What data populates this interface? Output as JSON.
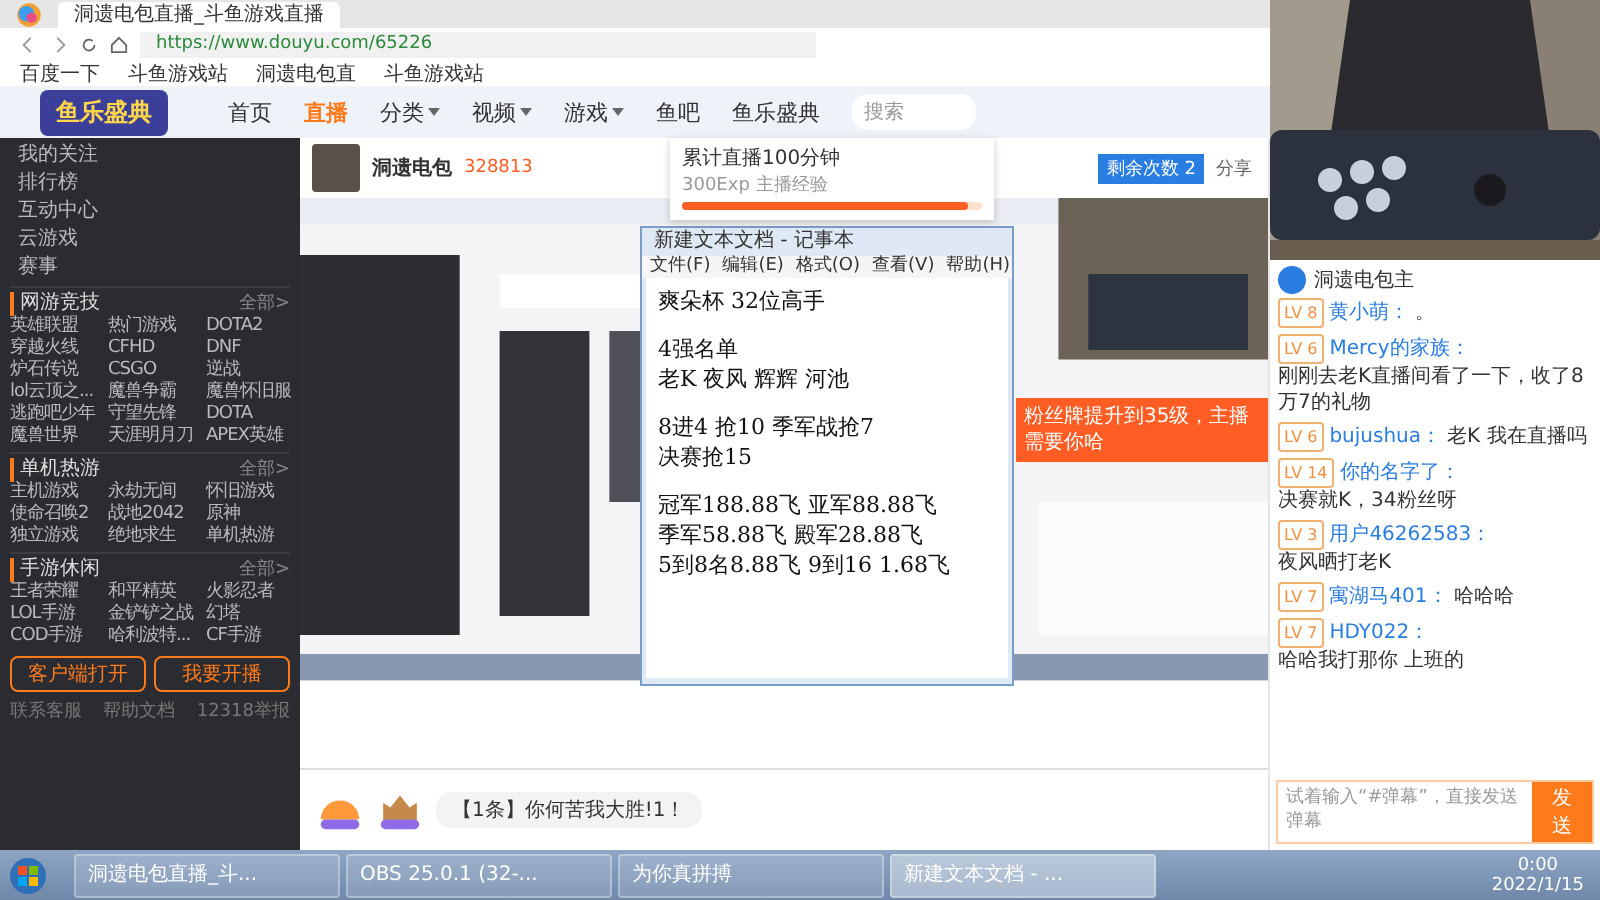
{
  "browser": {
    "tab_title": "洞遗电包直播_斗鱼游戏直播",
    "url": "https://www.douyu.com/65226",
    "bookmarks": [
      "百度一下",
      "斗鱼游戏站",
      "洞遗电包直",
      "斗鱼游戏站"
    ]
  },
  "site_nav": {
    "logo_text": "鱼乐盛典",
    "items": [
      {
        "label": "首页",
        "selected": false,
        "dropdown": false
      },
      {
        "label": "直播",
        "selected": true,
        "dropdown": false
      },
      {
        "label": "分类",
        "selected": false,
        "dropdown": true
      },
      {
        "label": "视频",
        "selected": false,
        "dropdown": true
      },
      {
        "label": "游戏",
        "selected": false,
        "dropdown": true
      },
      {
        "label": "鱼吧",
        "selected": false,
        "dropdown": false
      },
      {
        "label": "鱼乐盛典",
        "selected": false,
        "dropdown": false
      }
    ],
    "search_placeholder": "搜索"
  },
  "sidebar": {
    "nav": [
      "我的关注",
      "排行榜",
      "互动中心",
      "云游戏",
      "赛事"
    ],
    "sections": [
      {
        "title": "网游竞技",
        "more": "全部>",
        "items": [
          "英雄联盟",
          "热门游戏",
          "DOTA2",
          "穿越火线",
          "CFHD",
          "DNF",
          "炉石传说",
          "CSGO",
          "逆战",
          "lol云顶之...",
          "魔兽争霸",
          "魔兽怀旧服",
          "逃跑吧少年",
          "守望先锋",
          "DOTA",
          "魔兽世界",
          "天涯明月刀",
          "APEX英雄"
        ]
      },
      {
        "title": "单机热游",
        "more": "全部>",
        "items": [
          "主机游戏",
          "永劫无间",
          "怀旧游戏",
          "使命召唤2",
          "战地2042",
          "原神",
          "独立游戏",
          "绝地求生",
          "单机热游"
        ]
      },
      {
        "title": "手游休闲",
        "more": "全部>",
        "items": [
          "王者荣耀",
          "和平精英",
          "火影忍者",
          "LOL手游",
          "金铲铲之战",
          "幻塔",
          "COD手游",
          "哈利波特...",
          "CF手游"
        ]
      }
    ],
    "buttons": [
      "客户端打开",
      "我要开播"
    ],
    "footer": [
      "联系客服",
      "帮助文档",
      "12318举报"
    ]
  },
  "stream": {
    "streamer": "洞遗电包",
    "heat": "328813",
    "share": "分享",
    "remaining": "剩余次数",
    "remaining_count": "2"
  },
  "popup": {
    "title": "累计直播100分钟",
    "subtitle": "300Exp 主播经验",
    "level": 0.95
  },
  "notepad": {
    "title": "新建文本文档 - 记事本",
    "menu": [
      "文件(F)",
      "编辑(E)",
      "格式(O)",
      "查看(V)",
      "帮助(H)"
    ],
    "lines": [
      "爽朵杯 32位高手",
      "4强名单",
      "老K 夜风 辉辉 河池",
      "8进4 抢10 季军战抢7",
      "决赛抢15",
      "冠军188.88飞 亚军88.88飞",
      "季军58.88飞 殿军28.88飞",
      "5到8名8.88飞 9到16 1.68飞"
    ]
  },
  "banner": "粉丝牌提升到35级，主播需要你哈",
  "marquee": "【1条】你何苦我大胜!1！",
  "chat": {
    "host": "洞遗电包主",
    "messages": [
      {
        "level": "LV 8",
        "user": "黄小萌：",
        "text": "。"
      },
      {
        "level": "LV 6",
        "user": "Mercy的家族：",
        "text": "刚刚去老K直播间看了一下，收了8万7的礼物"
      },
      {
        "level": "LV 6",
        "user": "bujushua：",
        "text": "老K 我在直播吗"
      },
      {
        "level": "LV 14",
        "user": "你的名字了：",
        "text": "决赛就K，34粉丝呀"
      },
      {
        "level": "LV 3",
        "user": "用户46262583：",
        "text": "夜风晒打老K"
      },
      {
        "level": "LV 7",
        "user": "寓湖马401：",
        "text": "哈哈哈"
      },
      {
        "level": "LV 7",
        "user": "HDY022：",
        "text": "哈哈我打那你 上班的"
      }
    ],
    "placeholder": "试着输入“#弹幕”，直接发送弹幕",
    "send": "发送"
  },
  "taskbar": {
    "items": [
      {
        "label": "洞遗电包直播_斗...",
        "selected": false
      },
      {
        "label": "OBS 25.0.1 (32-...",
        "selected": false
      },
      {
        "label": "为你真拼搏",
        "selected": false
      },
      {
        "label": "新建文本文档 - ...",
        "selected": true
      }
    ],
    "time": "0:00",
    "date": "2022/1/15"
  }
}
